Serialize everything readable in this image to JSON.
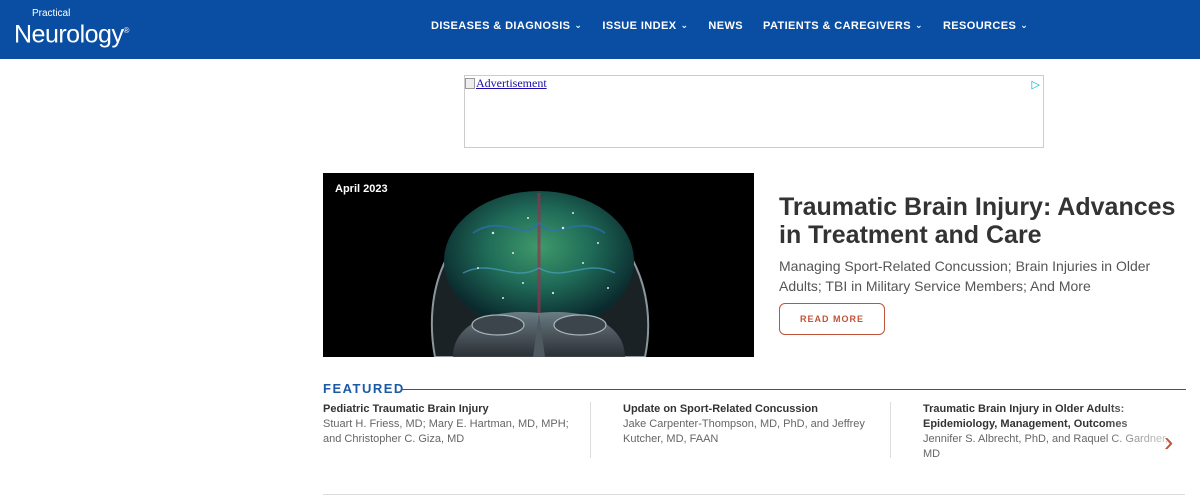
{
  "header": {
    "logo_small": "Practical",
    "logo_big": "Neurology",
    "logo_reg": "®",
    "nav": [
      {
        "label": "DISEASES & DIAGNOSIS",
        "chevron": "⌄",
        "has_chevron": true
      },
      {
        "label": "ISSUE INDEX",
        "chevron": "⌄",
        "has_chevron": true
      },
      {
        "label": "NEWS",
        "has_chevron": false
      },
      {
        "label": "PATIENTS & CAREGIVERS",
        "chevron": "⌄",
        "has_chevron": true
      },
      {
        "label": "RESOURCES",
        "chevron": "⌄",
        "has_chevron": true
      }
    ],
    "bg_color": "#0a4ea3"
  },
  "ad": {
    "alt_text": "Advertisement",
    "choice_icon": "▷"
  },
  "hero": {
    "badge": "April 2023",
    "title": "Traumatic Brain Injury: Advances in Treatment and Care",
    "subtitle": "Managing Sport-Related Concussion; Brain Injuries in Older Adults; TBI in Military Service Members; And More",
    "button": "READ MORE",
    "accent_color": "#c0543a"
  },
  "featured": {
    "label": "FEATURED",
    "cards": [
      {
        "title": "Pediatric Traumatic Brain Injury",
        "authors": "Stuart H. Friess, MD; Mary E. Hartman, MD, MPH; and Christopher C. Giza, MD"
      },
      {
        "title": "Update on Sport-Related Concussion",
        "authors": "Jake Carpenter-Thompson, MD, PhD, and Jeffrey Kutcher, MD, FAAN"
      },
      {
        "title": "Traumatic Brain Injury in Older Adults: Epidemiology, Management, Outcomes",
        "authors": "Jennifer S. Albrecht, PhD, and Raquel C. Gardner, MD"
      }
    ],
    "next_icon": "›"
  }
}
